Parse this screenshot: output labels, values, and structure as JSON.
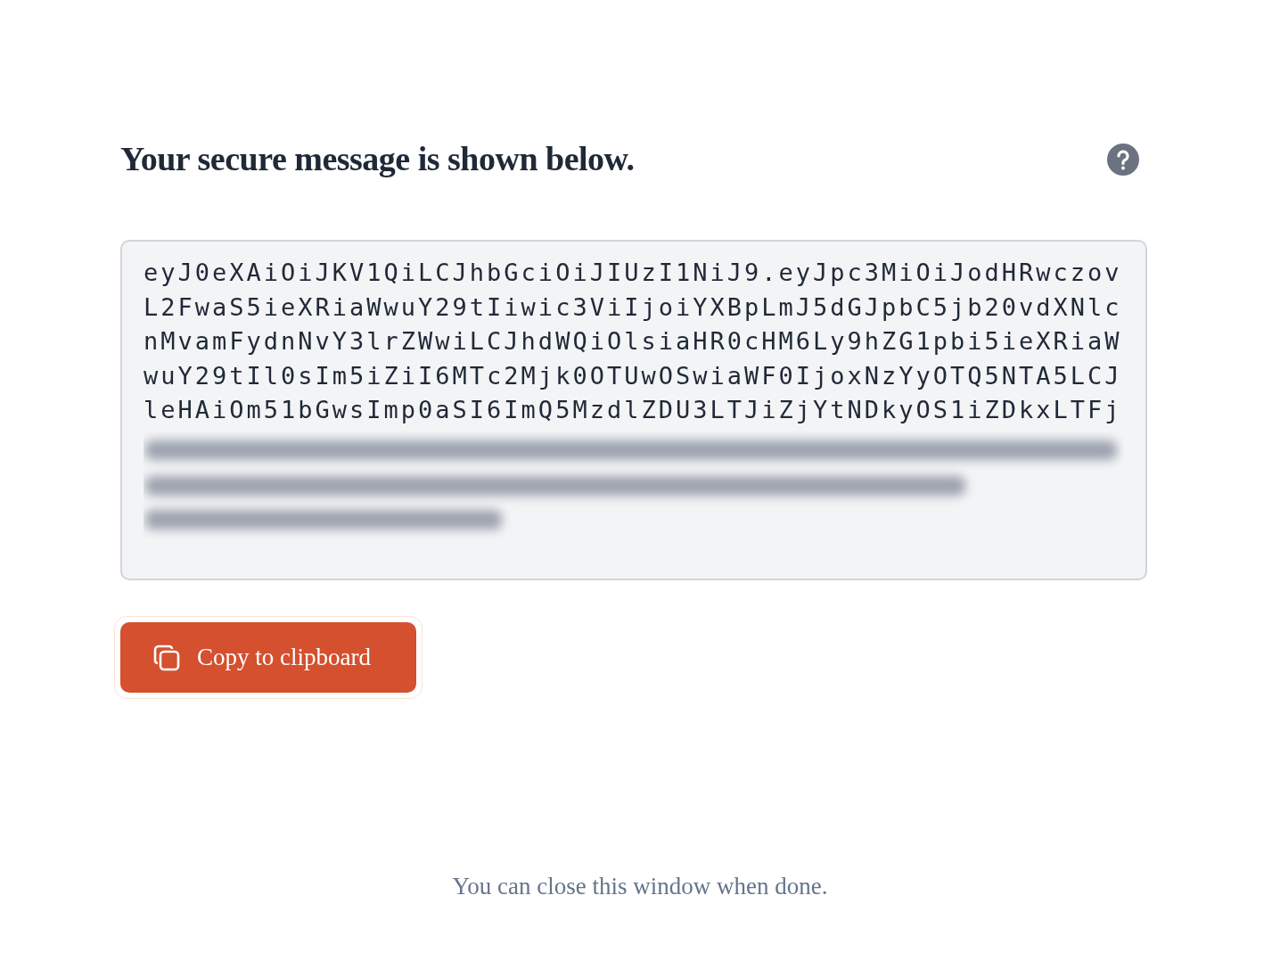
{
  "heading": "Your secure message is shown below.",
  "message_lines": [
    "eyJ0eXAiOiJKV1QiLCJhbGciOiJIUzI1NiJ9.eyJpc3MiOiJodHRwczov",
    "L2FwaS5ieXRiaWwuY29tIiwic3ViIjoiYXBpLmJ5dGJpbC5jb20vdXNlc",
    "nMvamFydnNvY3lrZWwiLCJhdWQiOlsiaHR0cHM6Ly9hZG1pbi5ieXRiaW",
    "wuY29tIl0sIm5iZiI6MTc2Mjk0OTUwOSwiaWF0IjoxNzYyOTQ5NTA5LCJ",
    "leHAiOm51bGwsImp0aSI6ImQ5MzdlZDU3LTJiZjYtNDkyOS1iZDkxLTFj"
  ],
  "copy_button": {
    "label": "Copy to clipboard"
  },
  "footer": "You can close this window when done."
}
